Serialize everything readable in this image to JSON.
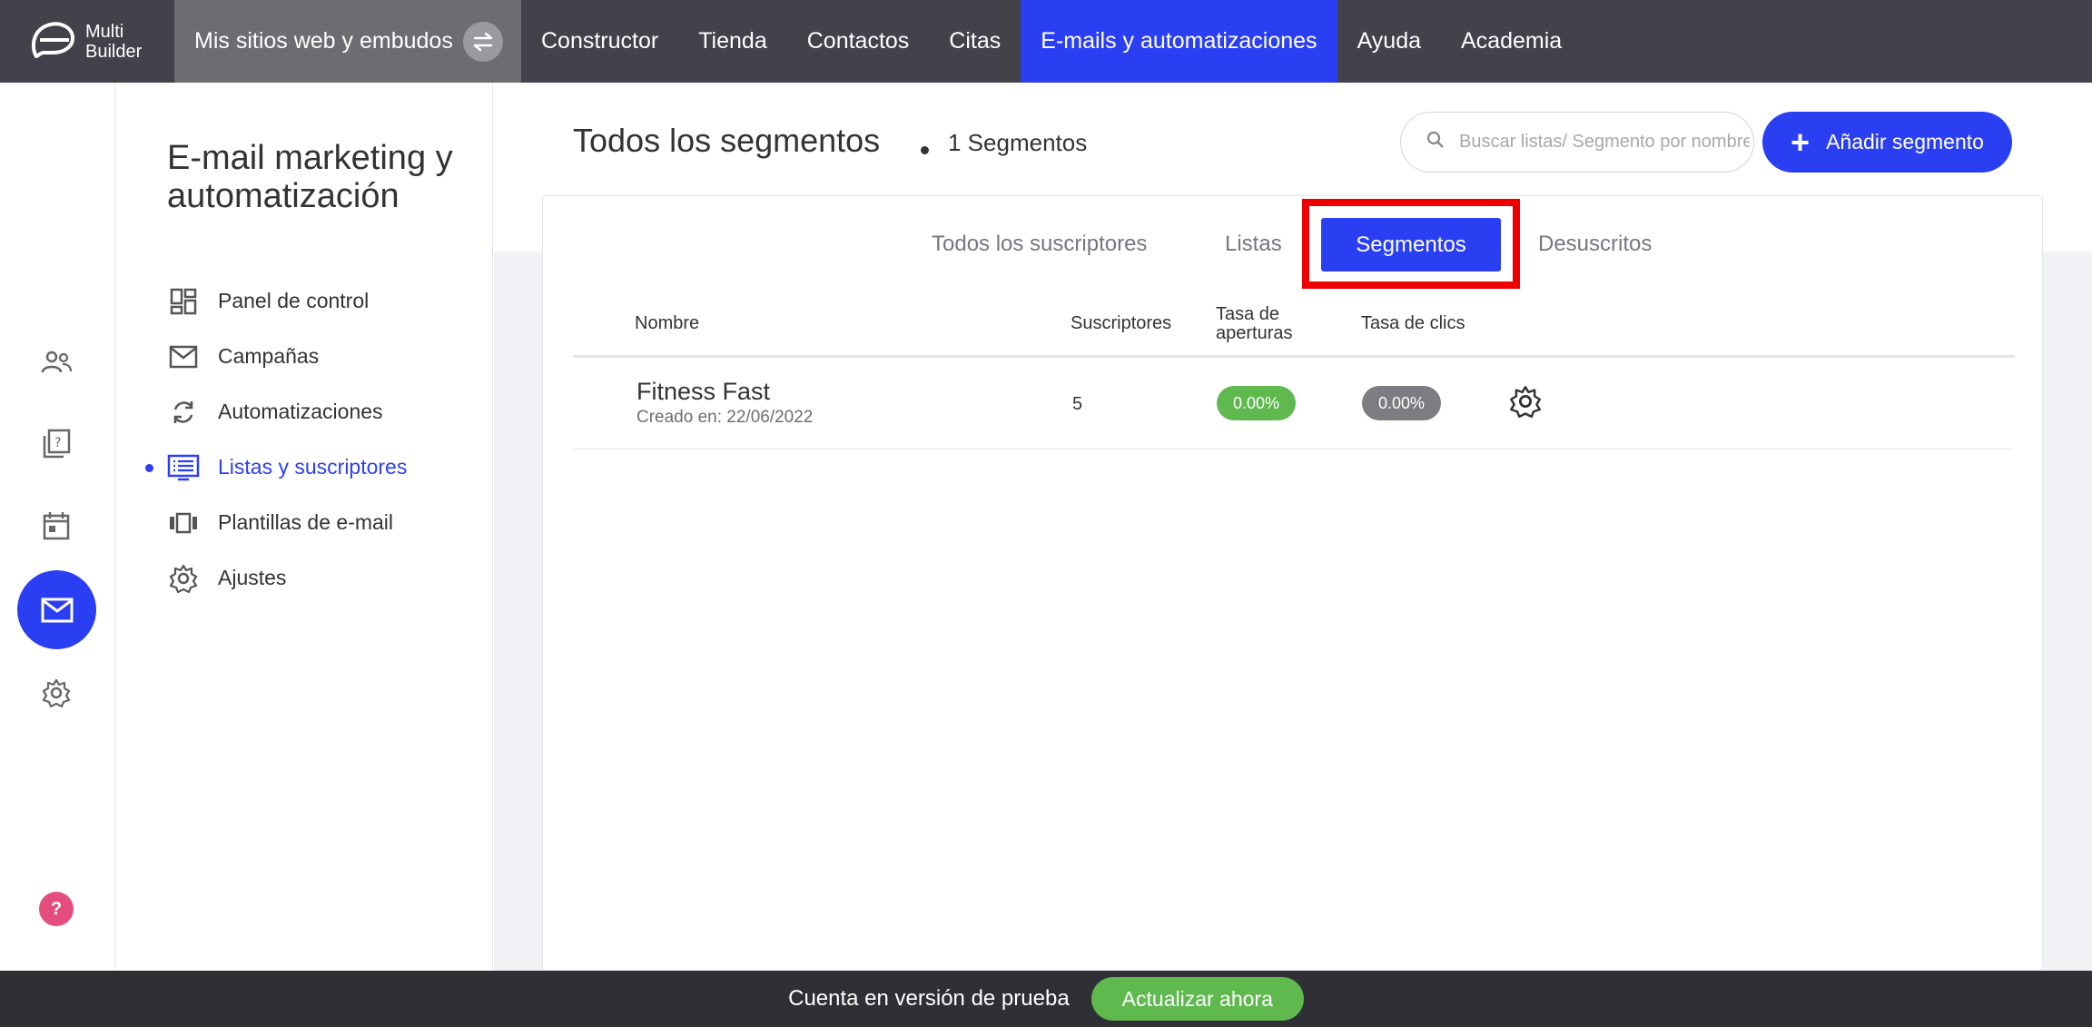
{
  "brand": {
    "name_line1": "Multi",
    "name_line2": "Builder"
  },
  "topnav": {
    "sites_label": "Mis sitios web y embudos",
    "items": [
      "Constructor",
      "Tienda",
      "Contactos",
      "Citas",
      "E-mails y automatizaciones",
      "Ayuda",
      "Academia"
    ],
    "active_item": "E-mails y automatizaciones"
  },
  "rail": {
    "icons": [
      "contacts-icon",
      "help-book-icon",
      "calendar-icon",
      "mail-icon",
      "gear-icon"
    ],
    "active": "mail-icon",
    "help_label": "?"
  },
  "sidebar": {
    "title": "E-mail marketing y automatización",
    "items": [
      {
        "label": "Panel de control",
        "icon": "dashboard-icon"
      },
      {
        "label": "Campañas",
        "icon": "mail-icon"
      },
      {
        "label": "Automatizaciones",
        "icon": "refresh-icon"
      },
      {
        "label": "Listas y suscriptores",
        "icon": "list-icon"
      },
      {
        "label": "Plantillas de e-mail",
        "icon": "templates-icon"
      },
      {
        "label": "Ajustes",
        "icon": "gear-icon"
      }
    ],
    "active_item": "Listas y suscriptores"
  },
  "main": {
    "title": "Todos los segmentos",
    "count": "1 Segmentos",
    "search_placeholder": "Buscar listas/ Segmento por nombre",
    "add_button": "Añadir segmento",
    "tabs": [
      "Todos los suscriptores",
      "Listas",
      "Segmentos",
      "Desuscritos"
    ],
    "active_tab": "Segmentos",
    "table": {
      "headers": {
        "name": "Nombre",
        "subscribers": "Suscriptores",
        "open_rate_line1": "Tasa de",
        "open_rate_line2": "aperturas",
        "click_rate": "Tasa de clics"
      },
      "rows": [
        {
          "name": "Fitness Fast",
          "created": "Creado en: 22/06/2022",
          "subscribers": "5",
          "open_rate": "0.00%",
          "click_rate": "0.00%"
        }
      ]
    }
  },
  "bottombar": {
    "trial_text": "Cuenta en versión de prueba",
    "upgrade_button": "Actualizar ahora"
  },
  "colors": {
    "accent": "#2b3ff2",
    "topnav": "#41424a",
    "highlight": "#ee0000",
    "green": "#5fb94f",
    "grey_pill": "#7c7d82"
  }
}
